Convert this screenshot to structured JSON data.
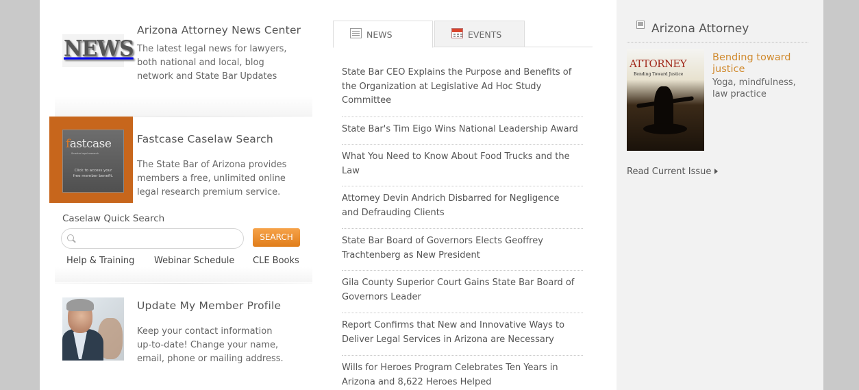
{
  "left": {
    "news_center": {
      "title": "Arizona Attorney News Center",
      "desc": [
        "The latest legal news for lawyers,",
        "both national and local, blog",
        "network and State Bar Updates"
      ],
      "logo_text": "NEWS"
    },
    "fastcase": {
      "title": "Fastcase Caselaw Search",
      "desc": [
        "The State Bar of Arizona provides",
        "members a free, unlimited online",
        "legal research premium service."
      ],
      "logo_prefix": "f",
      "logo_rest": "astcase",
      "tagline": "Smarter legal research",
      "cta": [
        "Click to access your",
        "free member benefit."
      ],
      "accent_color": "#c7661c"
    },
    "caselaw_search": {
      "label": "Caselaw Quick Search",
      "placeholder": "",
      "button": "SEARCH",
      "links": [
        "Help & Training",
        "Webinar Schedule",
        "CLE Books"
      ]
    },
    "profile": {
      "title": "Update My Member Profile",
      "desc": [
        "Keep your contact information",
        "up-to-date! Change your name,",
        "email, phone or mailing address."
      ]
    }
  },
  "tabs": [
    {
      "label": "NEWS",
      "icon": "newspaper-icon",
      "active": true
    },
    {
      "label": "EVENTS",
      "icon": "calendar-icon",
      "active": false
    }
  ],
  "news": [
    {
      "lines": [
        "State Bar CEO Explains the Purpose and Benefits of",
        "the Organization at Legislative Ad Hoc Study",
        "Committee"
      ]
    },
    {
      "lines": [
        "State Bar's Tim Eigo Wins National Leadership Award"
      ]
    },
    {
      "lines": [
        "What You Need to Know About Food Trucks and the",
        "Law"
      ]
    },
    {
      "lines": [
        "Attorney Devin Andrich Disbarred for Negligence",
        "and Defrauding Clients"
      ]
    },
    {
      "lines": [
        "State Bar Board of Governors Elects Geoffrey",
        "Trachtenberg as New President"
      ]
    },
    {
      "lines": [
        "Gila County Superior Court Gains State Bar Board of",
        "Governors Leader"
      ]
    },
    {
      "lines": [
        "Report Confirms that New and Innovative Ways to",
        "Deliver Legal Services in Arizona are Necessary"
      ]
    },
    {
      "lines": [
        "Wills for Heroes Program Celebrates Ten Years in",
        "Arizona and 8,622 Heroes Helped"
      ]
    }
  ],
  "magazine": {
    "heading": "Arizona Attorney",
    "cover_title": "ATTORNEY",
    "cover_subtitle": "Bending Toward Justice",
    "feature_title": [
      "Bending toward",
      "justice"
    ],
    "feature_sub": [
      "Yoga, mindfulness,",
      "law practice"
    ],
    "read_link": "Read Current Issue",
    "accent_color": "#d08a2e"
  }
}
